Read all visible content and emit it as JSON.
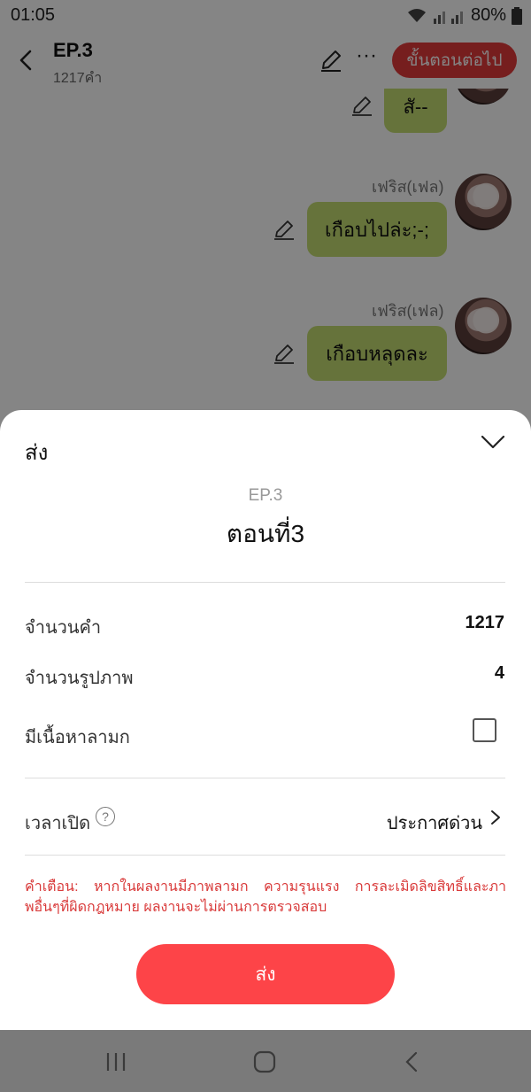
{
  "status_bar": {
    "time": "01:05",
    "battery": "80%"
  },
  "header": {
    "title": "EP.3",
    "word_count": "1217คำ",
    "next_button": "ขั้นตอนต่อไป"
  },
  "chat": {
    "messages": [
      {
        "sender": "",
        "text": "สั--"
      },
      {
        "sender": "เฟริส(เฟล)",
        "text": "เกือบไปล่ะ;-;"
      },
      {
        "sender": "เฟริส(เฟล)",
        "text": "เกือบหลุดละ"
      }
    ]
  },
  "sheet": {
    "title": "ส่ง",
    "episode_label": "EP.3",
    "episode_name": "ตอนที่3",
    "rows": {
      "word_count_label": "จำนวนคำ",
      "word_count_value": "1217",
      "image_count_label": "จำนวนรูปภาพ",
      "image_count_value": "4",
      "adult_label": "มีเนื้อหาลามก",
      "adult_checked": false,
      "publish_time_label": "เวลาเปิด",
      "publish_time_value": "ประกาศด่วน"
    },
    "warning": "คำเตือน: หากในผลงานมีภาพลามก ความรุนแรง การละเมิดลิขสิทธิ์และภาพอื่นๆที่ผิดกฎหมาย ผลงานจะไม่ผ่านการตรวจสอบ",
    "send_button": "ส่ง"
  },
  "colors": {
    "accent": "#fd4448",
    "bubble": "#c4dd72",
    "warning": "#d93a3a"
  },
  "icons": [
    "back-icon",
    "pencil-icon",
    "more-icon",
    "chevron-down-icon",
    "help-icon",
    "chevron-right-icon",
    "recent-apps-icon",
    "home-icon",
    "nav-back-icon",
    "wifi-icon",
    "signal-icon",
    "battery-icon"
  ]
}
